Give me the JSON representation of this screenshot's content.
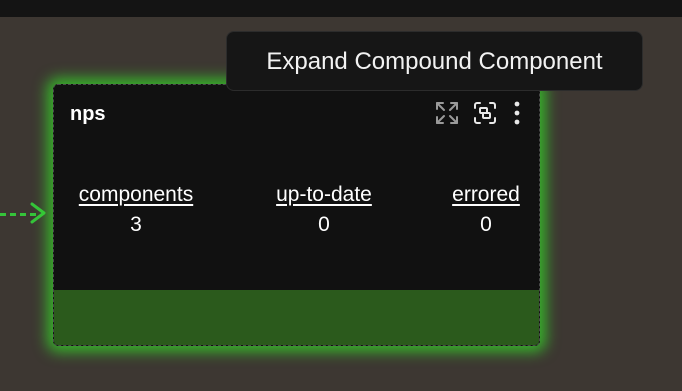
{
  "node": {
    "title": "nps",
    "actions": [
      {
        "icon": "expand-arrows-icon"
      },
      {
        "icon": "focus-compound-icon"
      },
      {
        "icon": "more-vertical-icon"
      }
    ],
    "stats": [
      {
        "label": "components",
        "value": "3"
      },
      {
        "label": "up-to-date",
        "value": "0"
      },
      {
        "label": "errored",
        "value": "0"
      }
    ]
  },
  "tooltip": {
    "text": "Expand Compound Component"
  },
  "colors": {
    "highlight_glow": "#35dc28",
    "footer": "#2b5a1c",
    "edge": "#35c43a"
  }
}
